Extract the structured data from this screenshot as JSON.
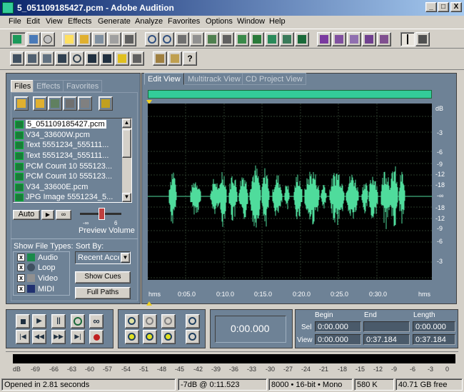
{
  "app": {
    "title": "5_051109185427.pcm - Adobe Audition",
    "window_buttons": [
      "_",
      "□",
      "X"
    ]
  },
  "menu": [
    "File",
    "Edit",
    "View",
    "Effects",
    "Generate",
    "Analyze",
    "Favorites",
    "Options",
    "Window",
    "Help"
  ],
  "toolbar_icons": {
    "row1": [
      "waveform-edit-icon",
      "multitrack-icon",
      "cd-project-icon",
      "new-file-icon",
      "open-file-icon",
      "save-icon",
      "close-icon",
      "insert-icon",
      "scissors-icon",
      "cut-icon",
      "copy-icon",
      "paste-icon",
      "paste-new-icon",
      "mix-paste-icon",
      "spectral-view-icon",
      "frequency-icon",
      "amplitude-icon",
      "selection-tool-icon",
      "scrub-tool-icon"
    ],
    "row2": [
      "show-files-icon",
      "show-effects-icon",
      "show-favorites-icon",
      "play-cursor-icon",
      "zoom-icon",
      "time-format-icon",
      "bar-icon",
      "cue-icon",
      "meter-icon",
      "batch-icon",
      "tip-icon",
      "help-icon"
    ]
  },
  "left_panel": {
    "tabs": [
      "Files",
      "Effects",
      "Favorites"
    ],
    "files": [
      "5_051109185427.pcm",
      "V34_33600W.pcm",
      "Text 5551234_555111...",
      "Text 5551234_555111...",
      "PCM Count 10 555123...",
      "PCM Count 10 555123...",
      "V34_33600E.pcm",
      "JPG Image 5551234_5..."
    ],
    "auto_button": "Auto",
    "preview_label": "Preview Volume",
    "slider_min": "-∞",
    "slider_max": "6",
    "show_file_types_label": "Show File Types:",
    "file_types": [
      "Audio",
      "Loop",
      "Video",
      "MIDI"
    ],
    "sort_by_label": "Sort By:",
    "sort_value": "Recent Acce",
    "show_cues_button": "Show Cues",
    "full_paths_button": "Full Paths"
  },
  "edit_panel": {
    "tabs": [
      "Edit View",
      "Multitrack View",
      "CD Project View"
    ],
    "db_labels": [
      "dB",
      "-3",
      "-6",
      "-9",
      "-12",
      "-18",
      "-∞",
      "-18",
      "-12",
      "-9",
      "-6",
      "-3"
    ],
    "time_labels": [
      "hms",
      "0:05.0",
      "0:10.0",
      "0:15.0",
      "0:20.0",
      "0:25.0",
      "0:30.0",
      "hms"
    ],
    "wave_color": "#4fdc9c"
  },
  "time_display": {
    "current": "0:00.000",
    "headers": [
      "Begin",
      "End",
      "Length"
    ],
    "rows": [
      {
        "label": "Sel",
        "begin": "0:00.000",
        "end": "",
        "length": "0:00.000"
      },
      {
        "label": "View",
        "begin": "0:00.000",
        "end": "0:37.184",
        "length": "0:37.184"
      }
    ]
  },
  "level_meter": {
    "labels": [
      "dB",
      "-69",
      "-66",
      "-63",
      "-60",
      "-57",
      "-54",
      "-51",
      "-48",
      "-45",
      "-42",
      "-39",
      "-36",
      "-33",
      "-30",
      "-27",
      "-24",
      "-21",
      "-18",
      "-15",
      "-12",
      "-9",
      "-6",
      "-3",
      "0"
    ]
  },
  "status": {
    "opened": "Opened in 2.81 seconds",
    "level": "-7dB @",
    "position": "0:11.523",
    "format": "8000 • 16-bit • Mono",
    "size": "580 K",
    "free": "40.71 GB free"
  }
}
